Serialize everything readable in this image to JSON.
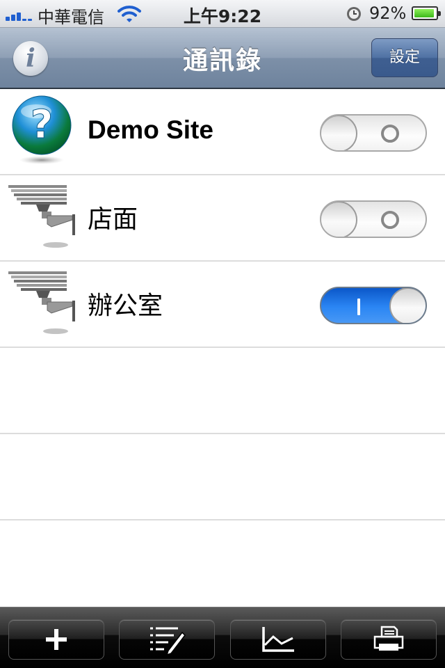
{
  "status_bar": {
    "carrier": "中華電信",
    "time": "上午9:22",
    "battery_percent": "92%",
    "battery_level": 0.92
  },
  "nav_bar": {
    "title": "通訊錄",
    "info_label": "i",
    "settings_label": "設定"
  },
  "rows": [
    {
      "label": "Demo Site",
      "icon": "help-globe-icon",
      "enabled": false
    },
    {
      "label": "店面",
      "icon": "security-camera-icon",
      "enabled": false
    },
    {
      "label": "辦公室",
      "icon": "security-camera-icon",
      "enabled": true
    }
  ],
  "toolbar": {
    "buttons": [
      "add-icon",
      "edit-list-icon",
      "chart-icon",
      "print-icon"
    ]
  },
  "colors": {
    "nav_bar": "#7d90a8",
    "toggle_on": "#2b86f4",
    "toolbar": "#000000"
  }
}
